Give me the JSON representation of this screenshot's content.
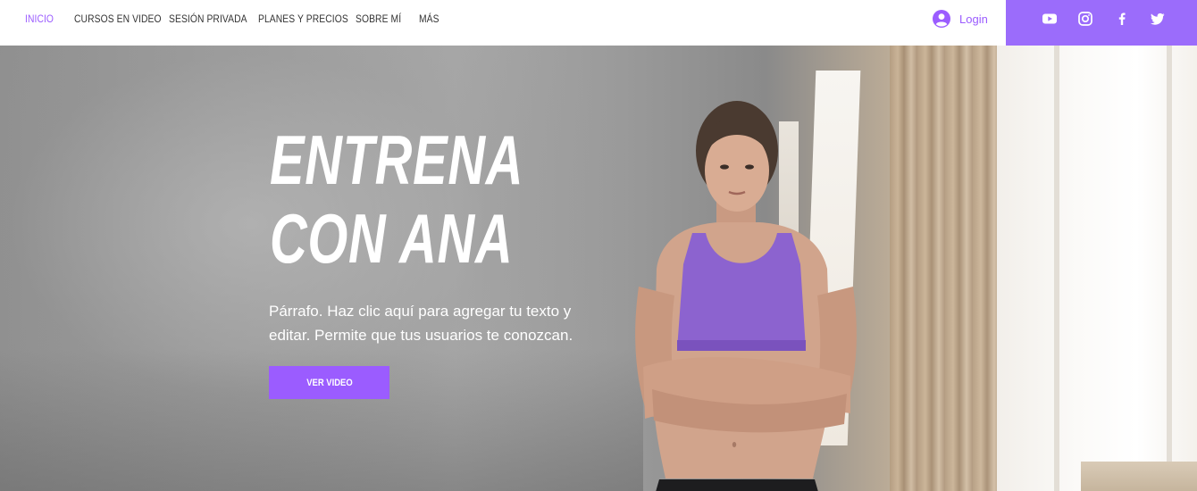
{
  "nav": {
    "items": [
      {
        "label": "INICIO",
        "active": true
      },
      {
        "label": "CURSOS EN VIDEO",
        "active": false
      },
      {
        "label": "SESIÓN PRIVADA",
        "active": false
      },
      {
        "label": "PLANES Y PRECIOS",
        "active": false
      },
      {
        "label": "SOBRE MÍ",
        "active": false
      },
      {
        "label": "MÁS",
        "active": false
      }
    ]
  },
  "login": {
    "label": "Login",
    "icon": "user-avatar-icon"
  },
  "social": {
    "icons": [
      "youtube-icon",
      "instagram-icon",
      "facebook-icon",
      "twitter-icon"
    ],
    "background": "#9b6cfb"
  },
  "hero": {
    "title_line1": "ENTRENA",
    "title_line2": "CON ANA",
    "paragraph": "Párrafo. Haz clic aquí para agregar tu texto y editar. Permite que tus usuarios te conozcan.",
    "cta_label": "VER VIDEO"
  },
  "colors": {
    "accent": "#9b5cff",
    "nav_text": "#333333",
    "hero_text": "#ffffff"
  }
}
